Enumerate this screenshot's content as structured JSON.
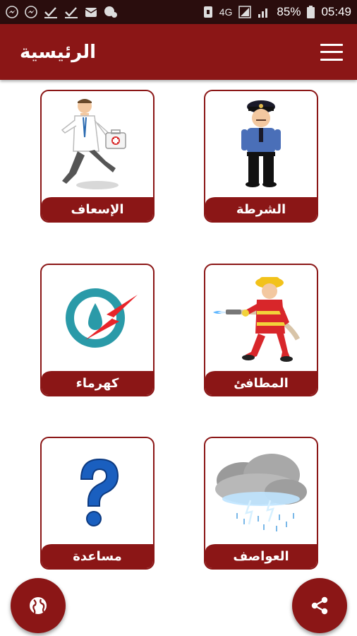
{
  "status_bar": {
    "battery": "85%",
    "time": "05:49",
    "network": "4G"
  },
  "app_bar": {
    "title": "الرئيسية",
    "menu_icon": "menu-icon"
  },
  "tiles": [
    {
      "label": "الشرطة",
      "icon": "police-officer-icon"
    },
    {
      "label": "الإسعاف",
      "icon": "paramedic-doctor-icon"
    },
    {
      "label": "المطافئ",
      "icon": "firefighter-icon"
    },
    {
      "label": "كهرماء",
      "icon": "kahramaa-logo-icon"
    },
    {
      "label": "العواصف",
      "icon": "storm-cloud-icon"
    },
    {
      "label": "مساعدة",
      "icon": "question-mark-icon"
    }
  ],
  "fabs": {
    "left_icon": "globe-icon",
    "right_icon": "share-icon"
  },
  "colors": {
    "primary": "#8b1616",
    "status_bar": "#2a0d0d",
    "background": "#ffffff"
  }
}
